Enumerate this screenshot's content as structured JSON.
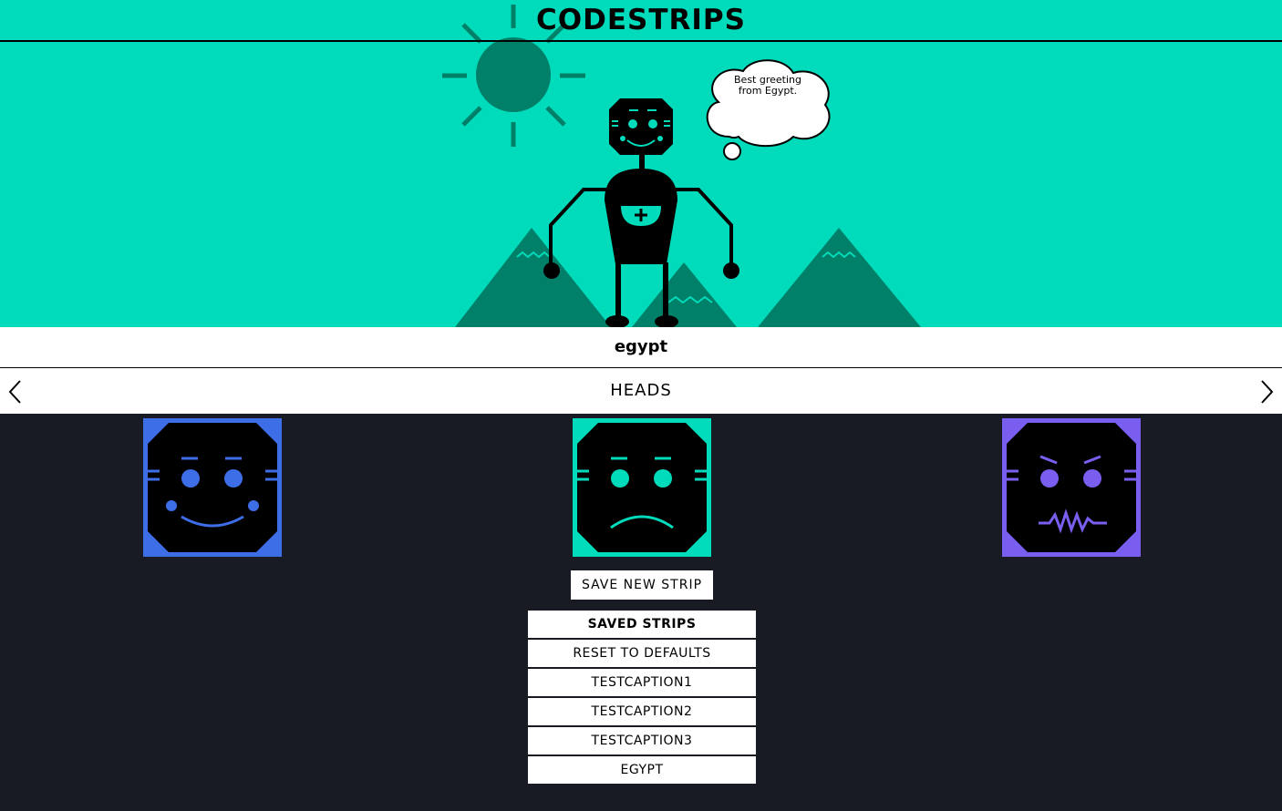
{
  "app": {
    "title": "CODESTRIPS"
  },
  "scene": {
    "speech_text": "Best greeting from Egypt."
  },
  "caption": {
    "text": "egypt"
  },
  "picker": {
    "section_label": "HEADS",
    "prev_icon": "chevron-left-icon",
    "next_icon": "chevron-right-icon",
    "options": [
      {
        "name": "happy",
        "color": "#3d6ee8"
      },
      {
        "name": "sad",
        "color": "#00dbbb"
      },
      {
        "name": "angry",
        "color": "#7a5ef0"
      }
    ]
  },
  "actions": {
    "save_label": "SAVE NEW STRIP"
  },
  "saved_strips": {
    "header": "SAVED STRIPS",
    "items": [
      "RESET TO DEFAULTS",
      "TESTCAPTION1",
      "TESTCAPTION2",
      "TESTCAPTION3",
      "EGYPT"
    ]
  },
  "colors": {
    "scene_bg": "#00dbbb",
    "scene_dark": "#008068",
    "page_bg": "#181b23"
  }
}
